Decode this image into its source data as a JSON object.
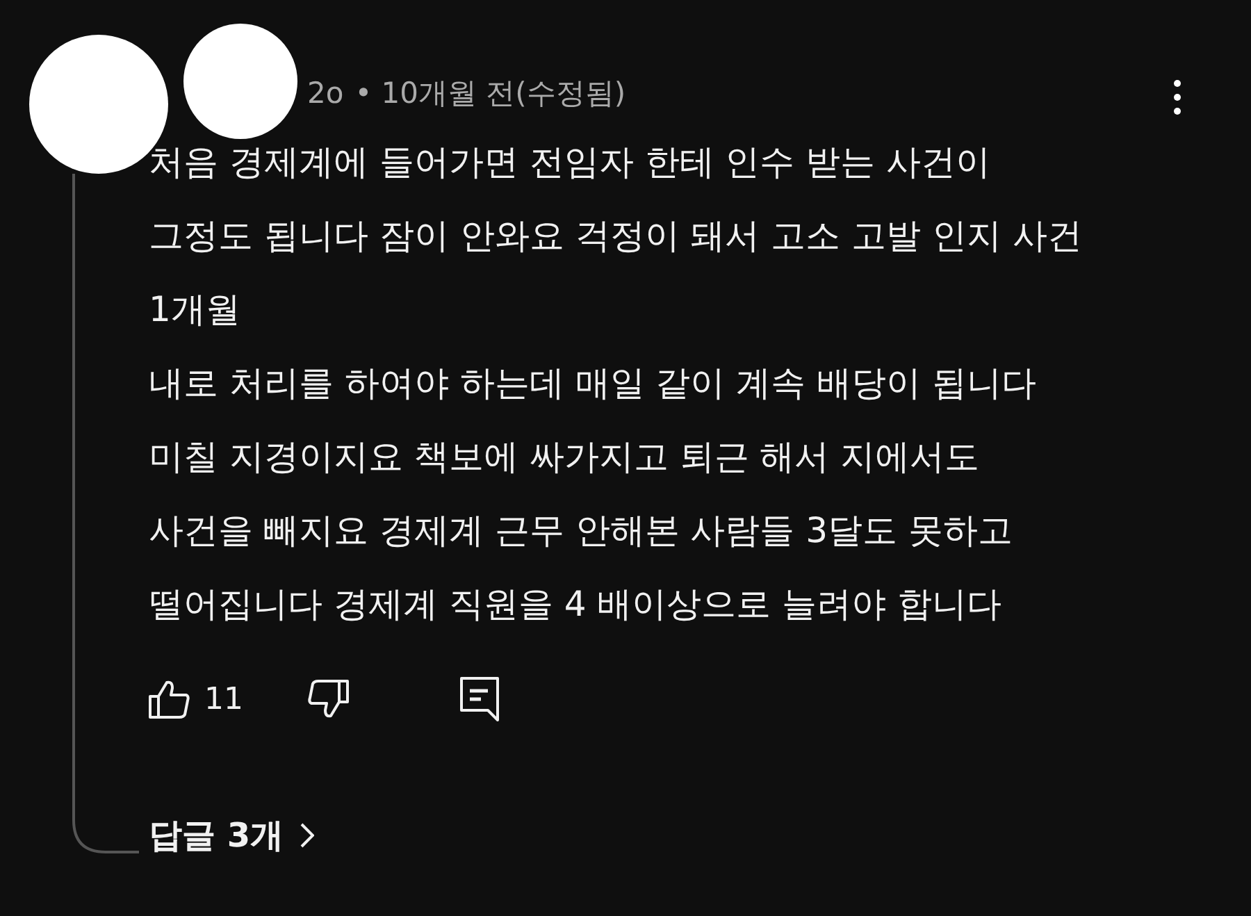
{
  "comment": {
    "handle_end": "2o",
    "meta": "• 10개월 전(수정됨)",
    "lines": [
      "처음 경제계에 들어가면 전임자 한테 인수 받는 사건이",
      "그정도 됩니다 잠이 안와요  걱정이 돼서 고소 고발 인지 사건",
      "1개월",
      "내로 처리를 하여야 하는데 매일 같이 계속 배당이 됩니다",
      "미칠 지경이지요 책보에 싸가지고 퇴근 해서 지에서도",
      "사건을 빼지요 경제계 근무 안해본 사람들 3달도 못하고",
      "떨어집니다 경제계 직원을 4 배이상으로 늘려야 합니다"
    ],
    "likes": "11",
    "replies": "답글 3개"
  }
}
